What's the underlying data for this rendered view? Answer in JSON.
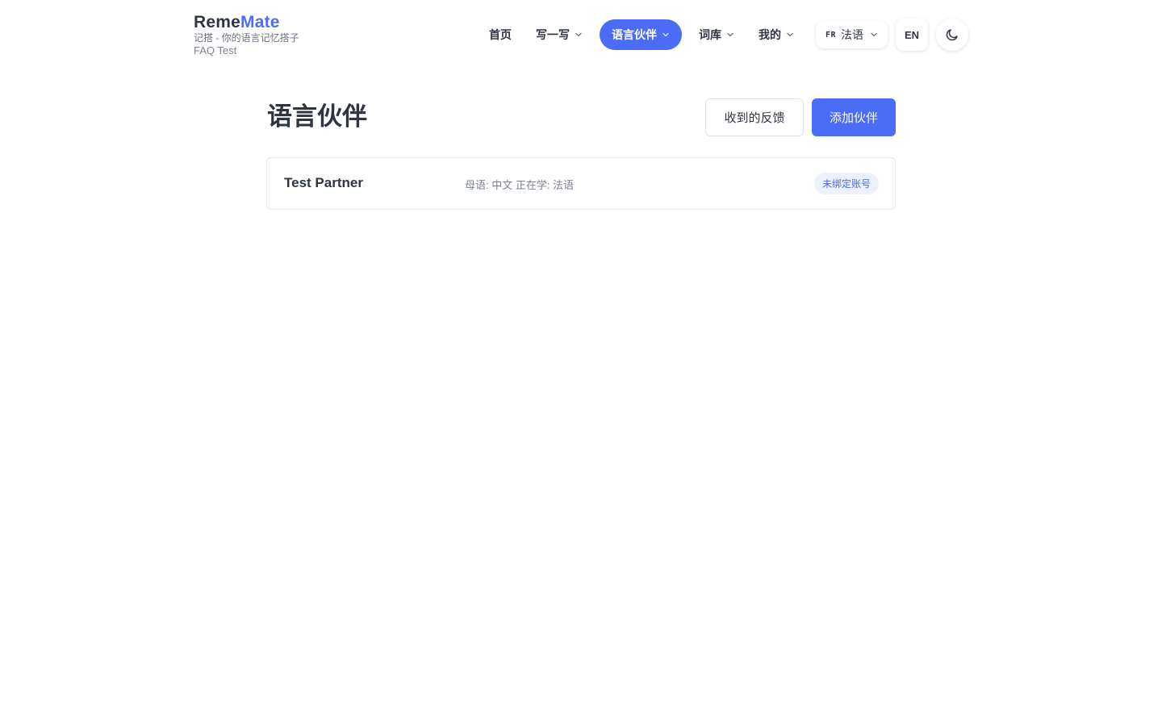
{
  "brand": {
    "name_part1": "Reme",
    "name_part2": "Mate",
    "tagline": "记搭 - 你的语言记忆搭子",
    "subtitle": "FAQ Test"
  },
  "nav": {
    "home": "首页",
    "write": "写一写",
    "partners": "语言伙伴",
    "vocab": "词库",
    "mine": "我的",
    "learning_language_code": "FR",
    "learning_language": "法语",
    "ui_language": "EN",
    "theme_icon": "moon-icon"
  },
  "page": {
    "title": "语言伙伴",
    "feedback_button": "收到的反馈",
    "add_button": "添加伙伴"
  },
  "partners": [
    {
      "name": "Test Partner",
      "languages": "母语: 中文 正在学: 法语",
      "badge": "未绑定账号"
    }
  ],
  "colors": {
    "accent": "#4a6cf7",
    "text": "#2f3541",
    "muted": "#7b8190",
    "badge_bg": "#edf0fe"
  }
}
